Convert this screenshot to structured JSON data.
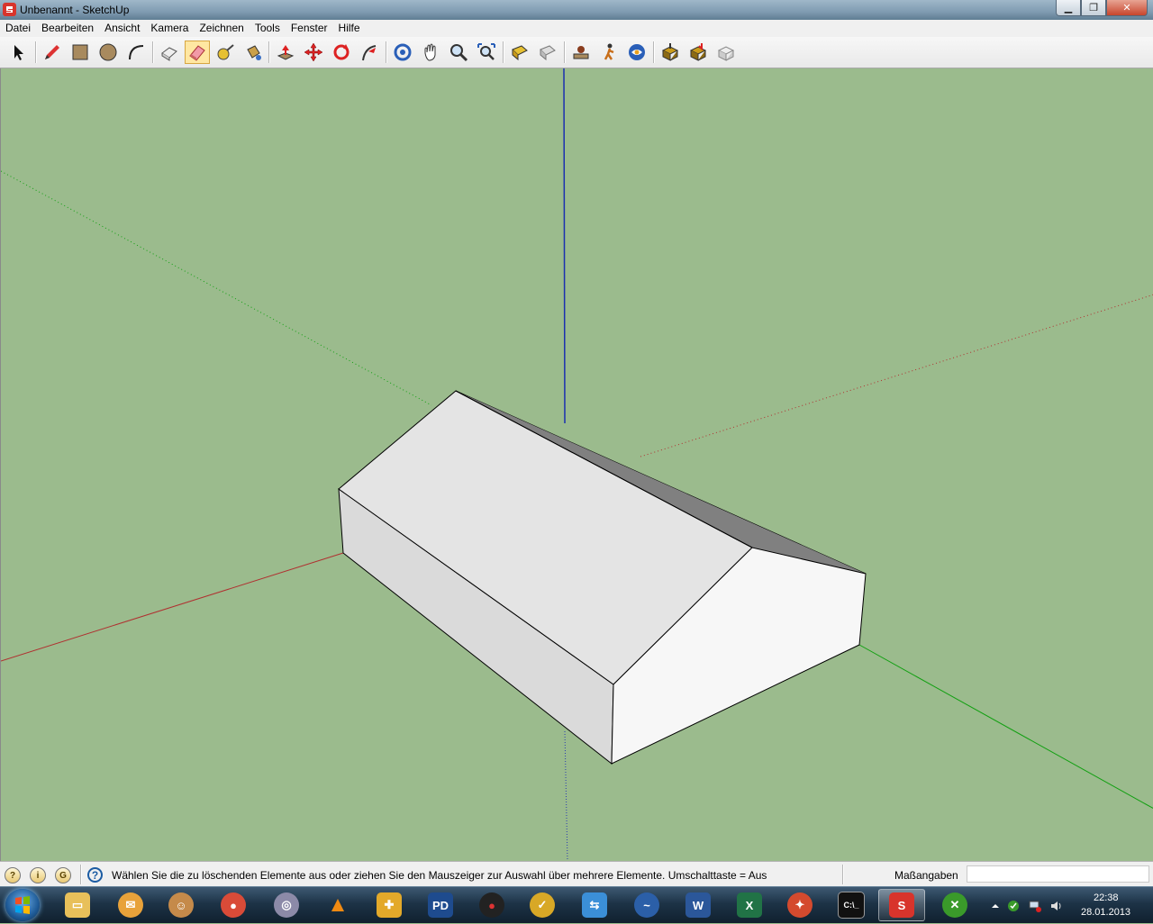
{
  "window": {
    "title": "Unbenannt - SketchUp",
    "minimize_label": "▁",
    "restore_label": "❐",
    "close_label": "✕"
  },
  "menu": [
    "Datei",
    "Bearbeiten",
    "Ansicht",
    "Kamera",
    "Zeichnen",
    "Tools",
    "Fenster",
    "Hilfe"
  ],
  "toolbar": {
    "tools": [
      "select-tool-icon",
      "line-pencil-tool-icon",
      "rectangle-tool-icon",
      "circle-tool-icon",
      "arc-tool-icon",
      "make-component-icon",
      "eraser-tool-icon",
      "tape-measure-tool-icon",
      "paint-bucket-tool-icon",
      "push-pull-tool-icon",
      "move-tool-icon",
      "rotate-tool-icon",
      "follow-me-tool-icon",
      "orbit-tool-icon",
      "pan-tool-icon",
      "zoom-tool-icon",
      "zoom-extents-tool-icon",
      "previous-view-icon",
      "next-view-icon",
      "position-camera-icon",
      "walk-tool-icon",
      "look-around-icon",
      "get-models-icon",
      "share-model-icon",
      "share-component-icon"
    ],
    "active_tool": "eraser-tool-icon"
  },
  "status": {
    "message": "Wählen Sie die zu löschenden Elemente aus oder ziehen Sie den Mauszeiger zur Auswahl über mehrere Elemente. Umschalttaste = Aus",
    "measurements_label": "Maßangaben",
    "measurements_value": ""
  },
  "taskbar": {
    "apps": [
      "explorer-icon",
      "thunderbird-icon",
      "gimp-icon",
      "chrome-icon",
      "dvd-icon",
      "vlc-icon",
      "puzzle-icon",
      "powerdvd-icon",
      "radio-icon",
      "norton-icon",
      "share-icon",
      "seamonkey-icon",
      "word-icon",
      "excel-icon",
      "fox-icon",
      "cmd-icon",
      "sketchup-icon",
      "xbox-icon"
    ],
    "active_app": "sketchup-icon",
    "clock_time": "22:38",
    "clock_date": "28.01.2013"
  },
  "colors": {
    "sky_ground": "#9bbb8d",
    "axis_red": "#b03030",
    "axis_green": "#12a012",
    "axis_blue": "#1a2fb0",
    "roof_face": "#e4e4e4",
    "roof_back": "#808080",
    "side_face": "#dadada",
    "gable_face": "#f7f7f7"
  }
}
